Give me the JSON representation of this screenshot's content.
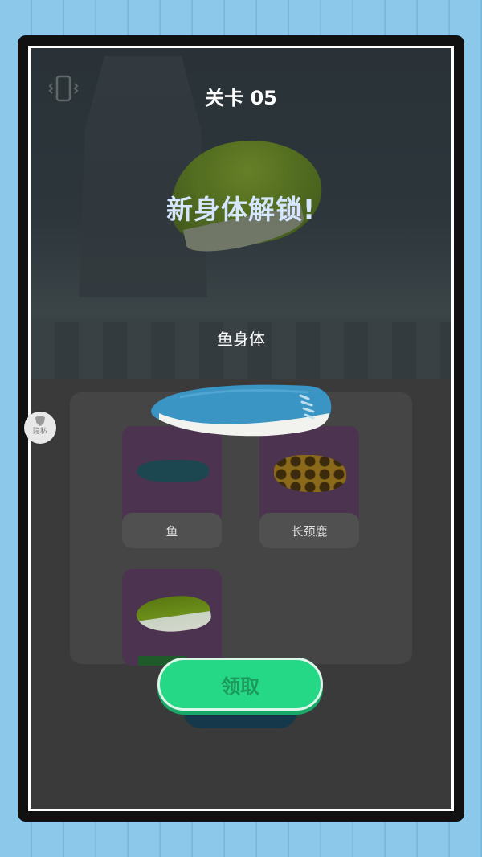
{
  "level": {
    "title": "关卡 05"
  },
  "unlock": {
    "title": "新身体解锁!",
    "part_name": "鱼身体"
  },
  "privacy": {
    "label": "隐私"
  },
  "cards": [
    {
      "label": "鱼",
      "icon": "fish-body-icon",
      "color": "#4c3350"
    },
    {
      "label": "长颈鹿",
      "icon": "giraffe-body-icon",
      "color": "#4c3350"
    },
    {
      "label": "",
      "icon": "green-body-icon",
      "color": "#4c3350"
    }
  ],
  "claim": {
    "label": "领取",
    "color": "#24d886"
  }
}
